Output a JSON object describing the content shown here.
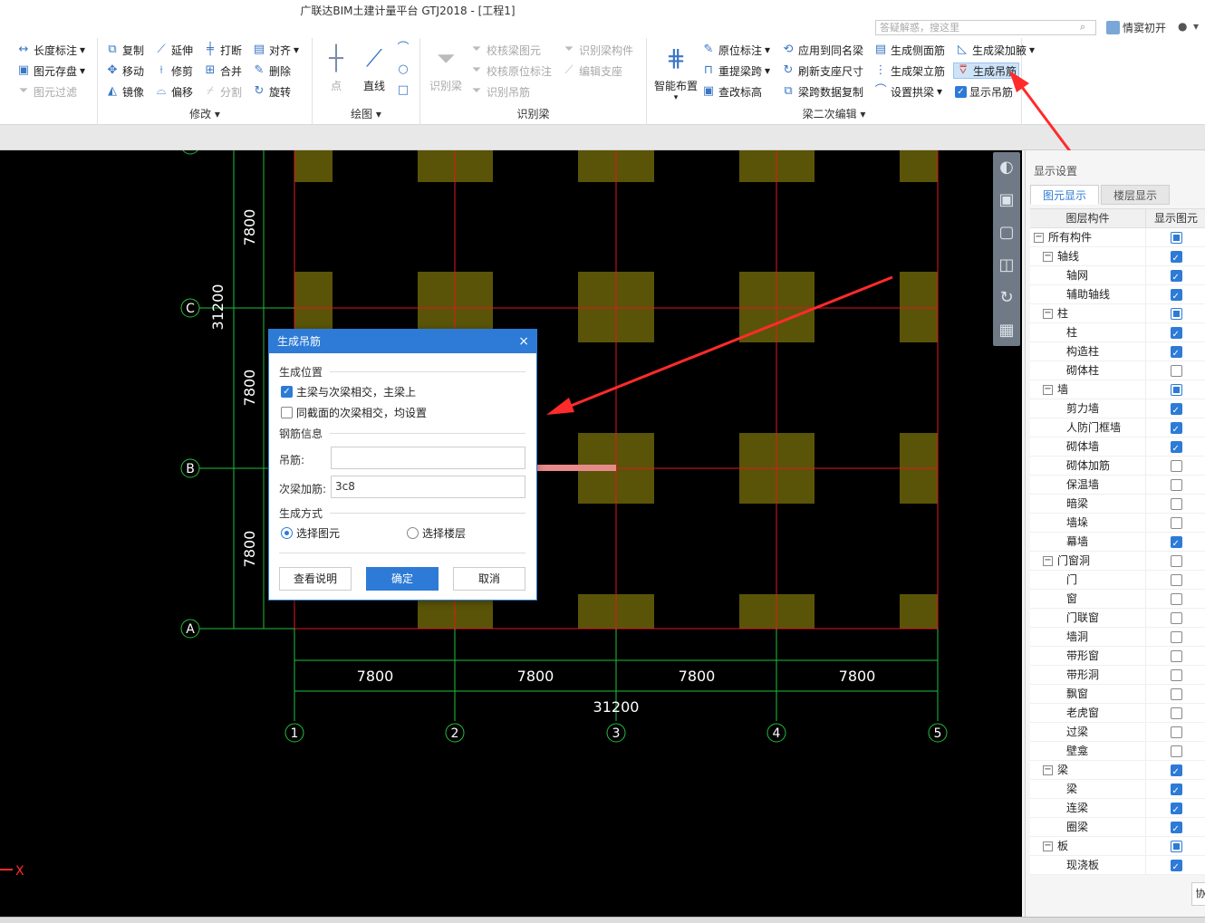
{
  "window": {
    "title": "广联达BIM土建计量平台 GTJ2018 - [工程1]"
  },
  "titlebar": {
    "search_placeholder": "答疑解惑，搜这里",
    "user_name": "情窦初开"
  },
  "ribbon": {
    "groups": {
      "edit": {
        "label": "修改",
        "items": [
          "长度标注",
          "图元存盘",
          "图元过滤",
          "复制",
          "移动",
          "镜像",
          "延伸",
          "修剪",
          "偏移",
          "打断",
          "合并",
          "分割",
          "对齐",
          "删除",
          "旋转"
        ]
      },
      "draw": {
        "label": "绘图",
        "items": [
          "点",
          "直线"
        ]
      },
      "identify": {
        "label": "识别梁",
        "items": [
          "识别梁",
          "校核梁图元",
          "校核原位标注",
          "识别吊筋",
          "识别梁构件",
          "编辑支座"
        ]
      },
      "beam_edit": {
        "label": "梁二次编辑",
        "items": [
          "智能布置",
          "原位标注",
          "重提梁跨",
          "查改标高",
          "应用到同名梁",
          "刷新支座尺寸",
          "梁跨数据复制",
          "生成侧面筋",
          "生成架立筋",
          "设置拱梁",
          "生成梁加腋",
          "生成吊筋",
          "显示吊筋"
        ]
      }
    }
  },
  "canvas": {
    "row_axes": [
      "C",
      "B",
      "A"
    ],
    "top_axis_partial": "D",
    "col_axes": [
      "1",
      "2",
      "3",
      "4",
      "5"
    ],
    "spans": [
      "7800",
      "7800",
      "7800",
      "7800"
    ],
    "row_spans": [
      "7800",
      "7800",
      "7800"
    ],
    "total": "31200",
    "total_vertical": "31200",
    "axis_indicator": "X"
  },
  "panel": {
    "title": "显示设置",
    "tabs": [
      "图元显示",
      "楼层显示"
    ],
    "col_component": "图层构件",
    "col_show": "显示图元",
    "rows": [
      {
        "label": "所有构件",
        "level": 0,
        "state": "partial",
        "expand": true
      },
      {
        "label": "轴线",
        "level": 1,
        "state": "on",
        "expand": true
      },
      {
        "label": "轴网",
        "level": 2,
        "state": "on"
      },
      {
        "label": "辅助轴线",
        "level": 2,
        "state": "on"
      },
      {
        "label": "柱",
        "level": 1,
        "state": "partial",
        "expand": true
      },
      {
        "label": "柱",
        "level": 2,
        "state": "on"
      },
      {
        "label": "构造柱",
        "level": 2,
        "state": "on"
      },
      {
        "label": "砌体柱",
        "level": 2,
        "state": "off"
      },
      {
        "label": "墙",
        "level": 1,
        "state": "partial",
        "expand": true
      },
      {
        "label": "剪力墙",
        "level": 2,
        "state": "on"
      },
      {
        "label": "人防门框墙",
        "level": 2,
        "state": "on"
      },
      {
        "label": "砌体墙",
        "level": 2,
        "state": "on"
      },
      {
        "label": "砌体加筋",
        "level": 2,
        "state": "off"
      },
      {
        "label": "保温墙",
        "level": 2,
        "state": "off"
      },
      {
        "label": "暗梁",
        "level": 2,
        "state": "off"
      },
      {
        "label": "墙垛",
        "level": 2,
        "state": "off"
      },
      {
        "label": "幕墙",
        "level": 2,
        "state": "on"
      },
      {
        "label": "门窗洞",
        "level": 1,
        "state": "off",
        "expand": true
      },
      {
        "label": "门",
        "level": 2,
        "state": "off"
      },
      {
        "label": "窗",
        "level": 2,
        "state": "off"
      },
      {
        "label": "门联窗",
        "level": 2,
        "state": "off"
      },
      {
        "label": "墙洞",
        "level": 2,
        "state": "off"
      },
      {
        "label": "带形窗",
        "level": 2,
        "state": "off"
      },
      {
        "label": "带形洞",
        "level": 2,
        "state": "off"
      },
      {
        "label": "飘窗",
        "level": 2,
        "state": "off"
      },
      {
        "label": "老虎窗",
        "level": 2,
        "state": "off"
      },
      {
        "label": "过梁",
        "level": 2,
        "state": "off"
      },
      {
        "label": "壁龛",
        "level": 2,
        "state": "off"
      },
      {
        "label": "梁",
        "level": 1,
        "state": "on",
        "expand": true
      },
      {
        "label": "梁",
        "level": 2,
        "state": "on"
      },
      {
        "label": "连梁",
        "level": 2,
        "state": "on"
      },
      {
        "label": "圈梁",
        "level": 2,
        "state": "on"
      },
      {
        "label": "板",
        "level": 1,
        "state": "partial",
        "expand": true
      },
      {
        "label": "现浇板",
        "level": 2,
        "state": "on"
      }
    ],
    "side_button": "协"
  },
  "dialog": {
    "title": "生成吊筋",
    "section_position": "生成位置",
    "opt1": "主梁与次梁相交，主梁上",
    "opt1_checked": true,
    "opt2": "同截面的次梁相交，均设置",
    "opt2_checked": false,
    "section_rebar": "钢筋信息",
    "hanger_label": "吊筋:",
    "hanger_value": "",
    "secondary_label": "次梁加筋:",
    "secondary_value": "3c8",
    "section_method": "生成方式",
    "radio1": "选择图元",
    "radio2": "选择楼层",
    "btn_help": "查看说明",
    "btn_ok": "确定",
    "btn_cancel": "取消"
  },
  "colors": {
    "accent": "#2d7bd6",
    "grid_red": "#e0191e",
    "grid_green": "#1fbf3a",
    "column": "#5a5408",
    "arrow": "#ff2b2b"
  }
}
